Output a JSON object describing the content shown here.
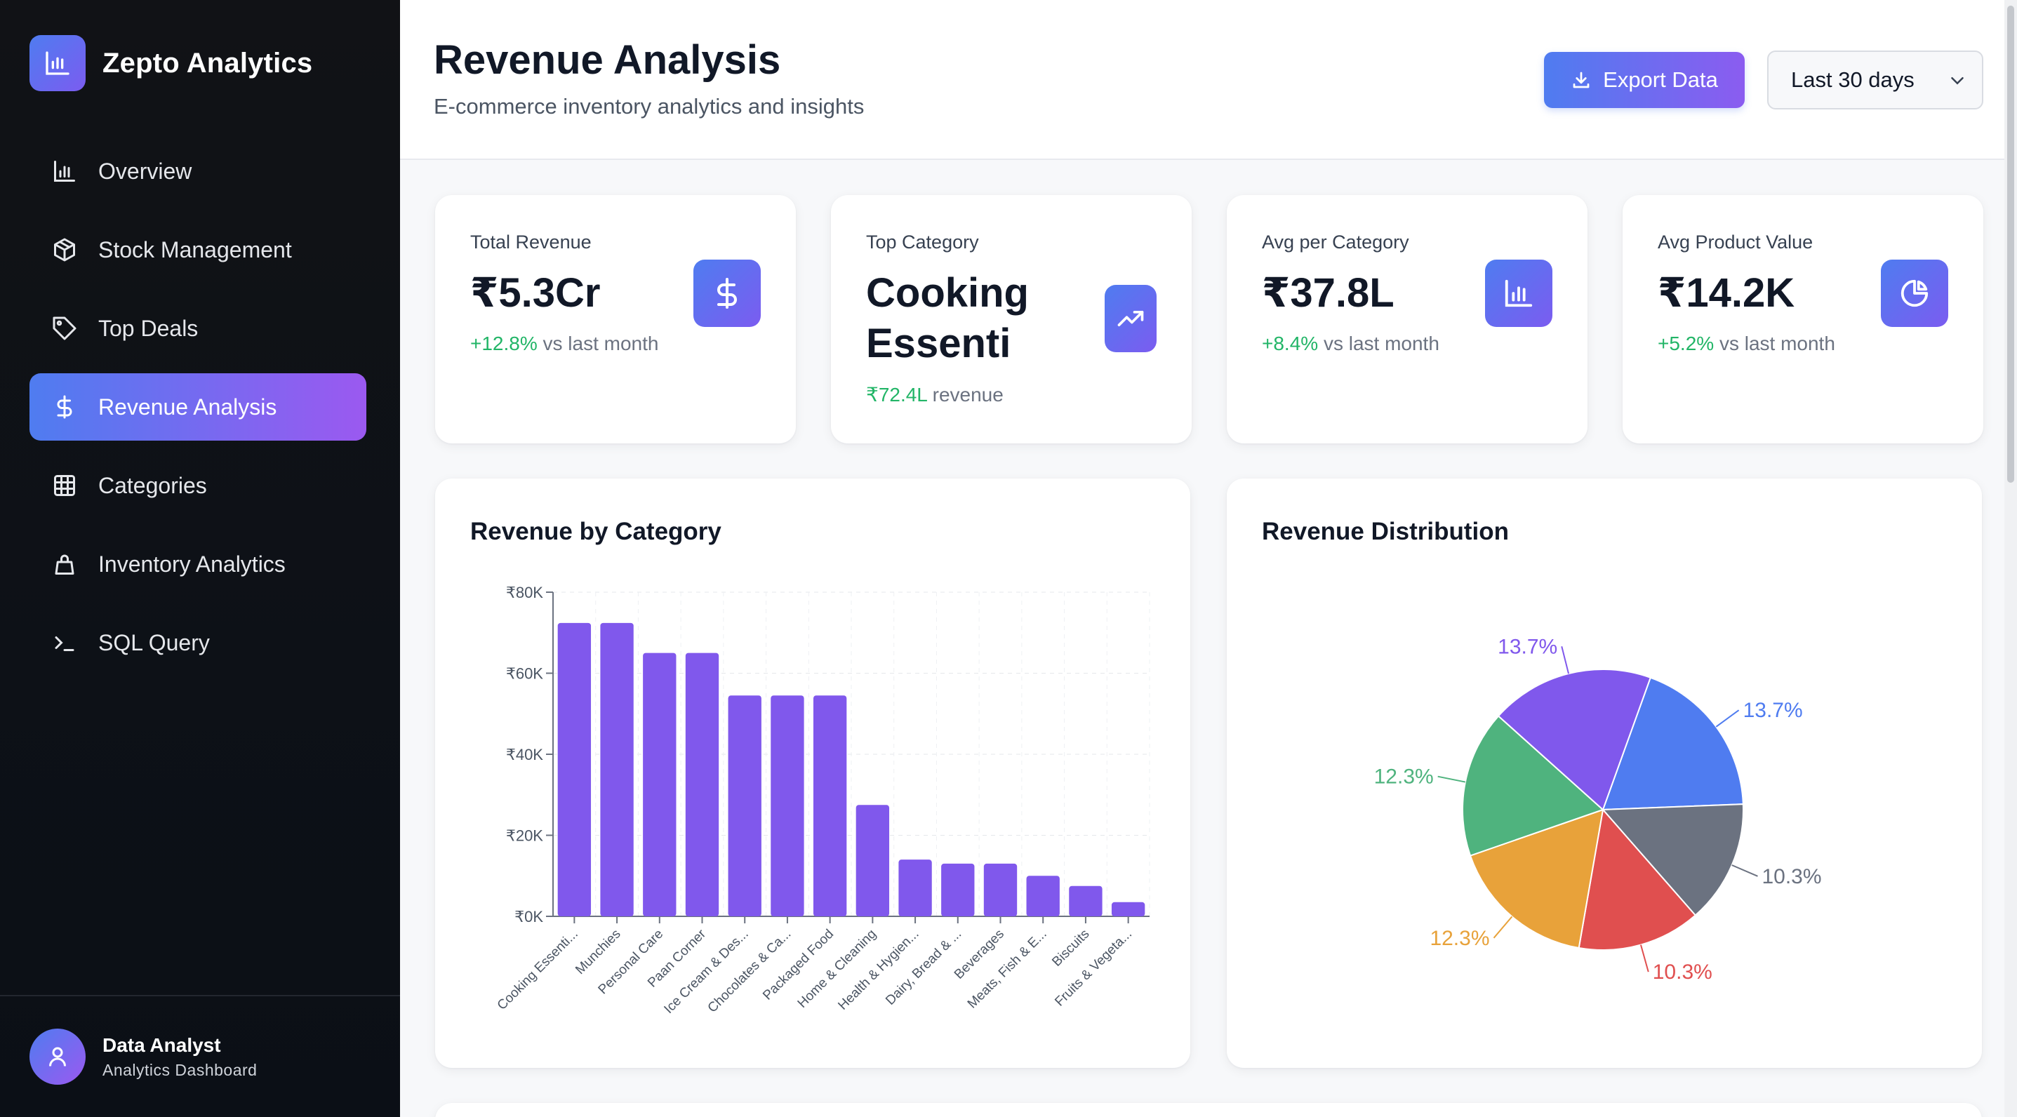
{
  "app": {
    "name": "Zepto Analytics"
  },
  "sidebar": {
    "items": [
      {
        "label": "Overview",
        "icon": "bar-chart-icon",
        "active": false
      },
      {
        "label": "Stock Management",
        "icon": "package-icon",
        "active": false
      },
      {
        "label": "Top Deals",
        "icon": "tag-icon",
        "active": false
      },
      {
        "label": "Revenue Analysis",
        "icon": "dollar-icon",
        "active": true
      },
      {
        "label": "Categories",
        "icon": "grid-icon",
        "active": false
      },
      {
        "label": "Inventory Analytics",
        "icon": "shopping-bag-icon",
        "active": false
      },
      {
        "label": "SQL Query",
        "icon": "terminal-icon",
        "active": false
      }
    ],
    "user": {
      "name": "Data Analyst",
      "role": "Analytics Dashboard"
    }
  },
  "header": {
    "title": "Revenue Analysis",
    "subtitle": "E-commerce inventory analytics and insights",
    "export_label": "Export Data",
    "date_range": "Last 30 days"
  },
  "kpis": [
    {
      "label": "Total Revenue",
      "value": "₹5.3Cr",
      "change": "+12.8%",
      "suffix": " vs last month",
      "icon": "dollar-icon"
    },
    {
      "label": "Top Category",
      "value_line1": "Cooking",
      "value_line2": "Essenti",
      "change": "₹72.4L",
      "suffix": " revenue",
      "icon": "trending-up-icon"
    },
    {
      "label": "Avg per Category",
      "value": "₹37.8L",
      "change": "+8.4%",
      "suffix": " vs last month",
      "icon": "bar-chart-icon"
    },
    {
      "label": "Avg Product Value",
      "value": "₹14.2K",
      "change": "+5.2%",
      "suffix": " vs last month",
      "icon": "pie-chart-icon"
    }
  ],
  "colors": {
    "accent_blue": "#4f7cf0",
    "accent_purple": "#8b5cf0",
    "bar": "#8058ec",
    "positive": "#22b567"
  },
  "chart_data": [
    {
      "type": "bar",
      "title": "Revenue by Category",
      "categories": [
        "Cooking Essenti...",
        "Munchies",
        "Personal Care",
        "Paan Corner",
        "Ice Cream & Des...",
        "Chocolates & Ca...",
        "Packaged Food",
        "Home & Cleaning",
        "Health & Hygien...",
        "Dairy, Bread & ...",
        "Beverages",
        "Meats, Fish & E...",
        "Biscuits",
        "Fruits & Vegeta..."
      ],
      "values": [
        72400,
        72400,
        65000,
        65000,
        54500,
        54500,
        54500,
        27500,
        14000,
        13000,
        13000,
        10000,
        7500,
        3500
      ],
      "yticks": [
        "₹0K",
        "₹20K",
        "₹40K",
        "₹60K",
        "₹80K"
      ],
      "ylim": [
        0,
        80000
      ],
      "grid": true
    },
    {
      "type": "pie",
      "title": "Revenue Distribution",
      "slices": [
        {
          "label": "13.7%",
          "value": 13.7,
          "color": "#4f7cf0"
        },
        {
          "label": "10.3%",
          "value": 10.3,
          "color": "#6b7280"
        },
        {
          "label": "10.3%",
          "value": 10.3,
          "color": "#e04f4f"
        },
        {
          "label": "12.3%",
          "value": 12.3,
          "color": "#e8a23a"
        },
        {
          "label": "12.3%",
          "value": 12.3,
          "color": "#4fb37e"
        },
        {
          "label": "13.7%",
          "value": 13.7,
          "color": "#8058ec"
        }
      ]
    }
  ]
}
